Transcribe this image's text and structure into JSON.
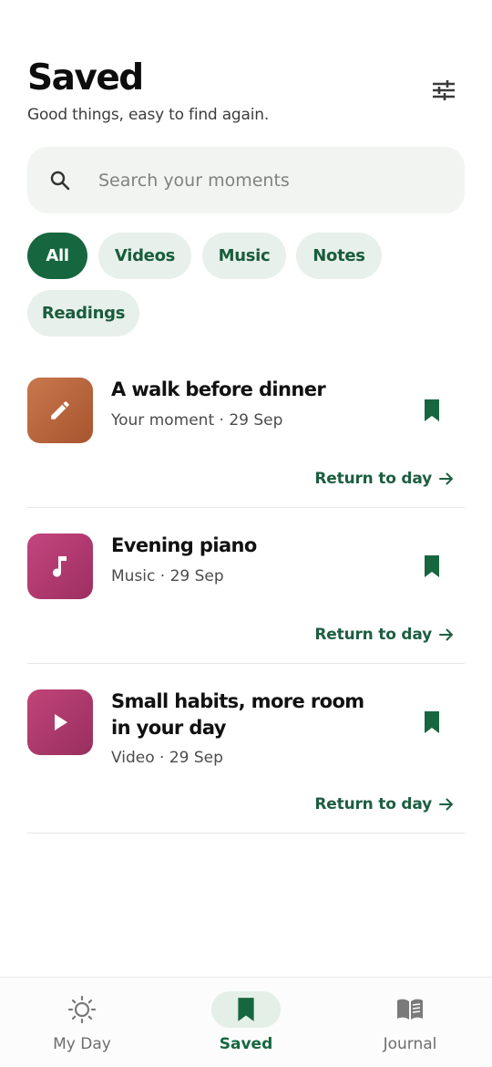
{
  "header": {
    "title": "Saved",
    "subtitle": "Good things, easy to find again."
  },
  "search": {
    "placeholder": "Search your moments"
  },
  "filters": [
    {
      "label": "All",
      "active": true
    },
    {
      "label": "Videos",
      "active": false
    },
    {
      "label": "Music",
      "active": false
    },
    {
      "label": "Notes",
      "active": false
    },
    {
      "label": "Readings",
      "active": false
    }
  ],
  "items": [
    {
      "title": "A walk before dinner",
      "meta": "Your moment · 29 Sep",
      "icon": "pencil-icon",
      "color": "#b8643f",
      "action": "Return to day"
    },
    {
      "title": "Evening piano",
      "meta": "Music · 29 Sep",
      "icon": "music-note-icon",
      "color": "#b23f73",
      "action": "Return to day"
    },
    {
      "title": "Small habits, more room in your day",
      "meta": "Video · 29 Sep",
      "icon": "play-icon",
      "color": "#ad3b6c",
      "action": "Return to day"
    }
  ],
  "nav": [
    {
      "label": "My Day",
      "icon": "sun-icon",
      "active": false
    },
    {
      "label": "Saved",
      "icon": "bookmark-icon",
      "active": true
    },
    {
      "label": "Journal",
      "icon": "book-icon",
      "active": false
    }
  ],
  "colors": {
    "accent": "#16673f",
    "chip_bg": "#e7f0ea"
  }
}
